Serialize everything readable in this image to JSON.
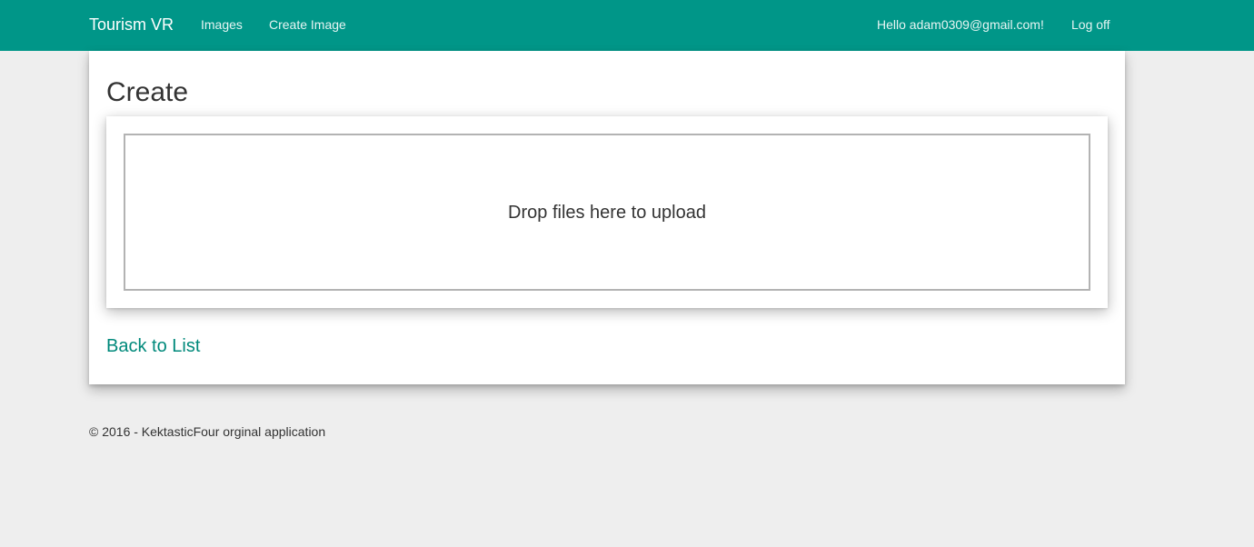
{
  "navbar": {
    "brand": "Tourism VR",
    "links": {
      "images": "Images",
      "create_image": "Create Image"
    },
    "user": {
      "greeting": "Hello adam0309@gmail.com!",
      "logoff": "Log off"
    },
    "color": "#009688"
  },
  "main": {
    "title": "Create",
    "dropzone": {
      "message": "Drop files here to upload"
    },
    "back_link": "Back to List",
    "link_color": "#00897b"
  },
  "footer": {
    "text": "© 2016 - KektasticFour orginal application"
  }
}
